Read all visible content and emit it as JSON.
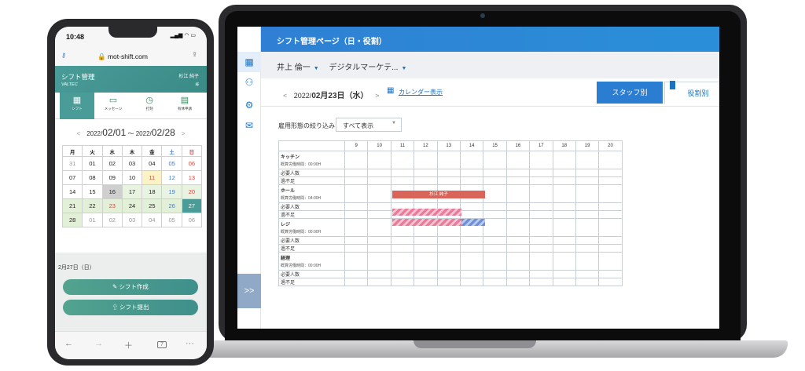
{
  "laptop": {
    "page_title": "シフト管理ページ（日・役割）",
    "sidebar_expand": ">>",
    "person": "井上 倫一",
    "department": "デジタルマーケテ...",
    "date_prefix": "2022/",
    "date_main": "02月23日",
    "date_weekday": "（水）",
    "prev": "<",
    "next": ">",
    "calendar_link": "カレンダー表示",
    "tab_staff": "スタッフ別",
    "tab_role": "役割別",
    "filter_label": "雇用形態の絞り込み",
    "filter_value": "すべて表示",
    "hours": [
      "9",
      "10",
      "11",
      "12",
      "13",
      "14",
      "15",
      "16",
      "17",
      "18",
      "19",
      "20"
    ],
    "roles": [
      {
        "name": "キッチン",
        "hours_label": "概算労働時間：00:00H",
        "required": "必要人数",
        "shortage": "過不足"
      },
      {
        "name": "ホール",
        "hours_label": "概算労働時間：04:00H",
        "required": "必要人数",
        "shortage": "過不足"
      },
      {
        "name": "レジ",
        "hours_label": "概算労働時間：00:00H",
        "required": "必要人数",
        "shortage": "過不足"
      },
      {
        "name": "経理",
        "hours_label": "概算労働時間：00:00H",
        "required": "必要人数",
        "shortage": "過不足"
      }
    ],
    "shift_bar_name": "杉江 純子",
    "colors": {
      "primary": "#2a7dd1",
      "shift": "#d9655a",
      "shortage": "#e87a9a",
      "excess": "#6d8fd6"
    }
  },
  "phone": {
    "time": "10:48",
    "url": "mot-shift.com",
    "title": "シフト管理",
    "brand": "VALTEC",
    "user": "杉江 純子",
    "user_suffix": "様",
    "nav": [
      {
        "label": "シフト",
        "icon": "calendar-icon"
      },
      {
        "label": "メッセージ",
        "icon": "message-icon"
      },
      {
        "label": "打刻",
        "icon": "clock-icon"
      },
      {
        "label": "有休申請",
        "icon": "leave-icon"
      }
    ],
    "range_year1": "2022/",
    "range_month1": "02/01",
    "range_sep": "～",
    "range_year2": "2022/",
    "range_month2": "02/28",
    "weekdays": [
      "月",
      "火",
      "水",
      "木",
      "金",
      "土",
      "日"
    ],
    "weeks": [
      [
        "31",
        "01",
        "02",
        "03",
        "04",
        "05",
        "06"
      ],
      [
        "07",
        "08",
        "09",
        "10",
        "11",
        "12",
        "13"
      ],
      [
        "14",
        "15",
        "16",
        "17",
        "18",
        "19",
        "20"
      ],
      [
        "21",
        "22",
        "23",
        "24",
        "25",
        "26",
        "27"
      ],
      [
        "28",
        "01",
        "02",
        "03",
        "04",
        "05",
        "06"
      ]
    ],
    "selected_date": "2月27日（日）",
    "btn_create": "シフト作成",
    "btn_submit": "シフト提出",
    "tabs_count": "7",
    "colors": {
      "accent": "#4a9c98"
    }
  }
}
